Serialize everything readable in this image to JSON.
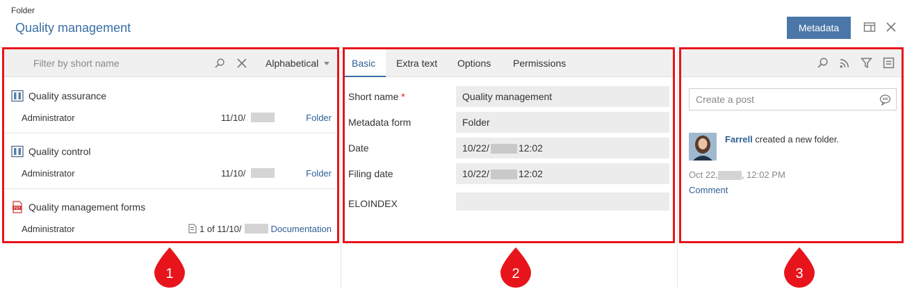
{
  "header": {
    "type_label": "Folder",
    "title": "Quality management",
    "metadata_button": "Metadata"
  },
  "panel1": {
    "filter_placeholder": "Filter by short name",
    "sort_label": "Alphabetical",
    "items": [
      {
        "title": "Quality assurance",
        "user": "Administrator",
        "date": "11/10/",
        "type": "Folder",
        "icon": "folder-icon"
      },
      {
        "title": "Quality control",
        "user": "Administrator",
        "date": "11/10/",
        "type": "Folder",
        "icon": "folder-icon"
      },
      {
        "title": "Quality management forms",
        "user": "Administrator",
        "date": "1 of 11/10/",
        "type": "Documentation",
        "icon": "pdf-icon"
      }
    ]
  },
  "panel2": {
    "tabs": [
      "Basic",
      "Extra text",
      "Options",
      "Permissions"
    ],
    "fields": {
      "short_name_label": "Short name",
      "short_name_required": "*",
      "short_name_value": "Quality management",
      "metadata_form_label": "Metadata form",
      "metadata_form_value": "Folder",
      "date_label": "Date",
      "date_value_a": "10/22/",
      "date_value_b": "12:02",
      "filing_date_label": "Filing date",
      "filing_date_value_a": "10/22/",
      "filing_date_value_b": "12:02",
      "eloindex_label": "ELOINDEX",
      "eloindex_value": ""
    }
  },
  "panel3": {
    "post_placeholder": "Create a post",
    "feed_user": "Farrell",
    "feed_action": " created a new folder.",
    "feed_date_a": "Oct 22,",
    "feed_date_b": ", 12:02 PM",
    "comment_label": "Comment"
  },
  "badges": [
    "1",
    "2",
    "3"
  ],
  "colors": {
    "accent": "#3a6ea5",
    "highlight": "#e8141b",
    "button": "#4a77a8"
  }
}
